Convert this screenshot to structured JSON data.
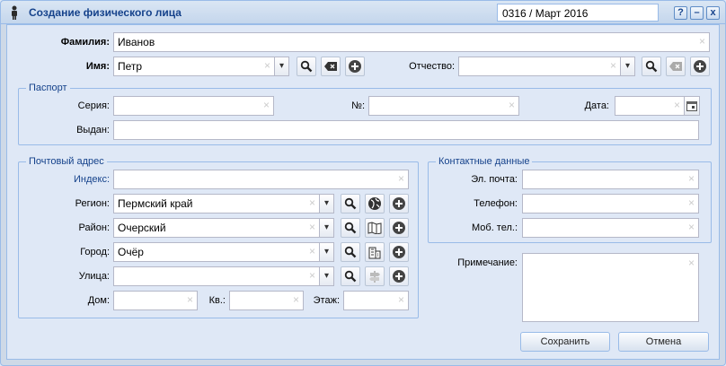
{
  "window": {
    "title": "Создание физического лица",
    "period": "0316 / Март 2016"
  },
  "tools": {
    "help": "?",
    "minimize": "–",
    "close": "x"
  },
  "person": {
    "surname_label": "Фамилия:",
    "surname_value": "Иванов",
    "name_label": "Имя:",
    "name_value": "Петр",
    "patronymic_label": "Отчество:",
    "patronymic_value": ""
  },
  "passport": {
    "title": "Паспорт",
    "series_label": "Серия:",
    "series_value": "",
    "number_label": "№:",
    "number_value": "",
    "date_label": "Дата:",
    "date_value": "",
    "issued_label": "Выдан:",
    "issued_value": ""
  },
  "address": {
    "title": "Почтовый адрес",
    "index_label": "Индекс:",
    "index_value": "",
    "region_label": "Регион:",
    "region_value": "Пермский край",
    "district_label": "Район:",
    "district_value": "Очерский",
    "city_label": "Город:",
    "city_value": "Очёр",
    "street_label": "Улица:",
    "street_value": "",
    "house_label": "Дом:",
    "house_value": "",
    "apt_label": "Кв.:",
    "apt_value": "",
    "floor_label": "Этаж:",
    "floor_value": ""
  },
  "contacts": {
    "title": "Контактные данные",
    "email_label": "Эл. почта:",
    "email_value": "",
    "phone_label": "Телефон:",
    "phone_value": "",
    "mobile_label": "Моб. тел.:",
    "mobile_value": ""
  },
  "note": {
    "label": "Примечание:",
    "value": ""
  },
  "actions": {
    "save": "Сохранить",
    "cancel": "Отмена"
  },
  "icons": {
    "clear": "×",
    "dropdown": "▾"
  },
  "colors": {
    "accent": "#15428b",
    "border": "#99bbe8",
    "panel": "#dfe8f6"
  }
}
